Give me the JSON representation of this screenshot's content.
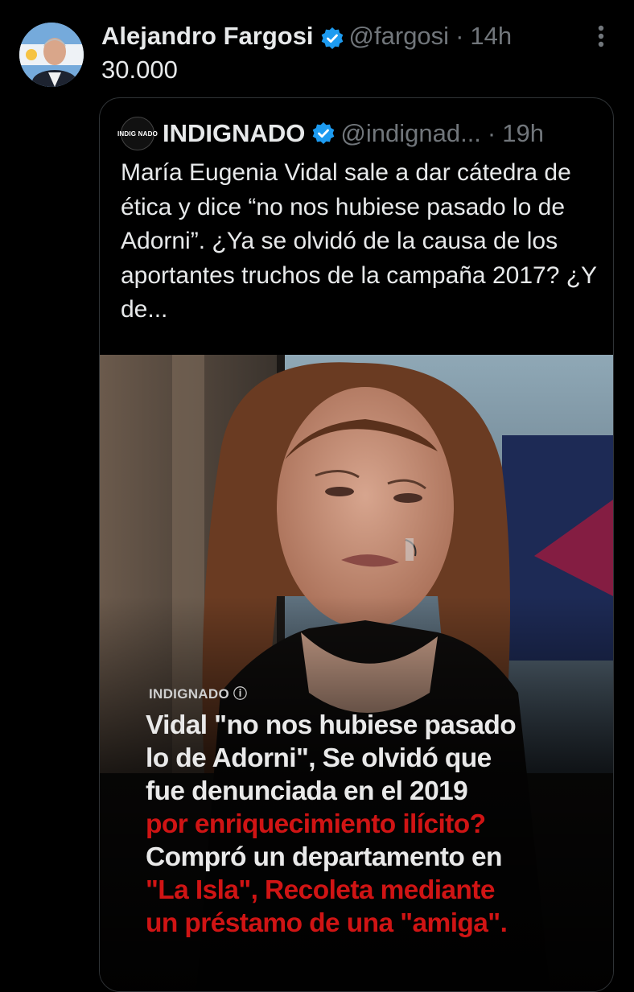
{
  "tweet": {
    "author_name": "Alejandro Fargosi",
    "handle": "@fargosi",
    "time": "14h",
    "text": "30.000"
  },
  "quoted": {
    "avatar_text": "INDIG NADO",
    "author_name": "INDIGNADO",
    "handle": "@indignad...",
    "time": "19h",
    "text": "María Eugenia Vidal sale a dar cátedra de ética y dice “no nos hubiese pasado lo de Adorni”. ¿Ya se olvidó de la causa de los aportantes truchos de la campaña 2017? ¿Y de...",
    "image": {
      "brand": "INDIGNADO ⓘ",
      "headline_lines": [
        {
          "text": "Vidal \"no nos hubiese pasado",
          "color": "white"
        },
        {
          "text": "lo de Adorni\", Se olvidó que",
          "color": "white"
        },
        {
          "text": "fue denunciada en el 2019",
          "color": "white"
        },
        {
          "text": "por enriquecimiento ilícito?",
          "color": "red"
        },
        {
          "text": "Compró un departamento en",
          "color": "white"
        },
        {
          "text": "\"La Isla\", Recoleta mediante",
          "color": "red"
        },
        {
          "text": "un préstamo de una \"amiga\".",
          "color": "red"
        }
      ]
    }
  },
  "colors": {
    "background": "#000000",
    "text": "#e7e9ea",
    "muted": "#71767b",
    "verified_blue": "#1d9bf0",
    "border": "#2f3336",
    "headline_red": "#d01414"
  }
}
